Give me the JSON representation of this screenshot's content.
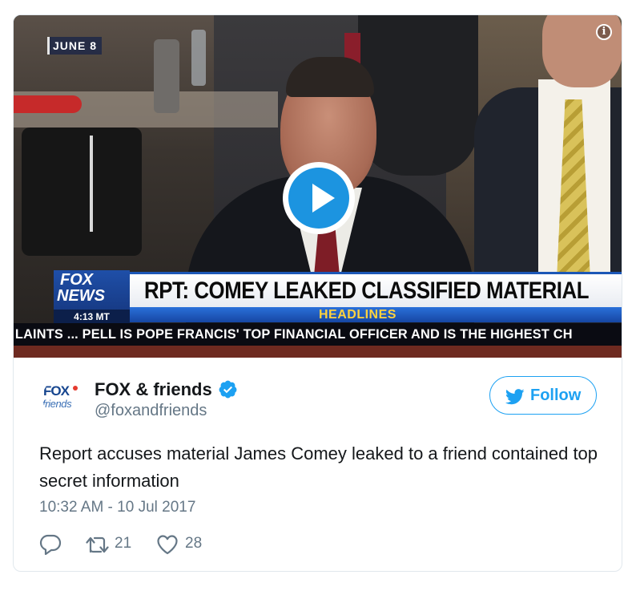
{
  "video": {
    "date_tag": "JUNE 8",
    "info_label": "i",
    "chyron": {
      "headline": "RPT: COMEY LEAKED CLASSIFIED MATERIAL",
      "section": "HEADLINES",
      "logo_line1": "FOX",
      "logo_line2": "NEWS",
      "time": "4:13 MT",
      "ticker": "LAINTS ... PELL IS POPE FRANCIS' TOP FINANCIAL OFFICER AND IS THE HIGHEST CH"
    }
  },
  "tweet": {
    "avatar": {
      "logo_top": "FOX",
      "logo_bottom": "friends"
    },
    "display_name": "FOX & friends",
    "handle": "@foxandfriends",
    "verified": true,
    "follow_label": "Follow",
    "text": "Report accuses material James Comey leaked to a friend contained top secret information",
    "timestamp": "10:32 AM - 10 Jul 2017",
    "actions": {
      "reply_count": "",
      "retweet_count": "21",
      "like_count": "28"
    }
  },
  "colors": {
    "twitter_blue": "#1da1f2",
    "play_blue": "#1c94e0",
    "secondary_text": "#657786",
    "primary_text": "#14171a"
  },
  "icons": [
    "info-icon",
    "play-icon",
    "verified-icon",
    "twitter-bird-icon",
    "reply-icon",
    "retweet-icon",
    "heart-icon"
  ]
}
